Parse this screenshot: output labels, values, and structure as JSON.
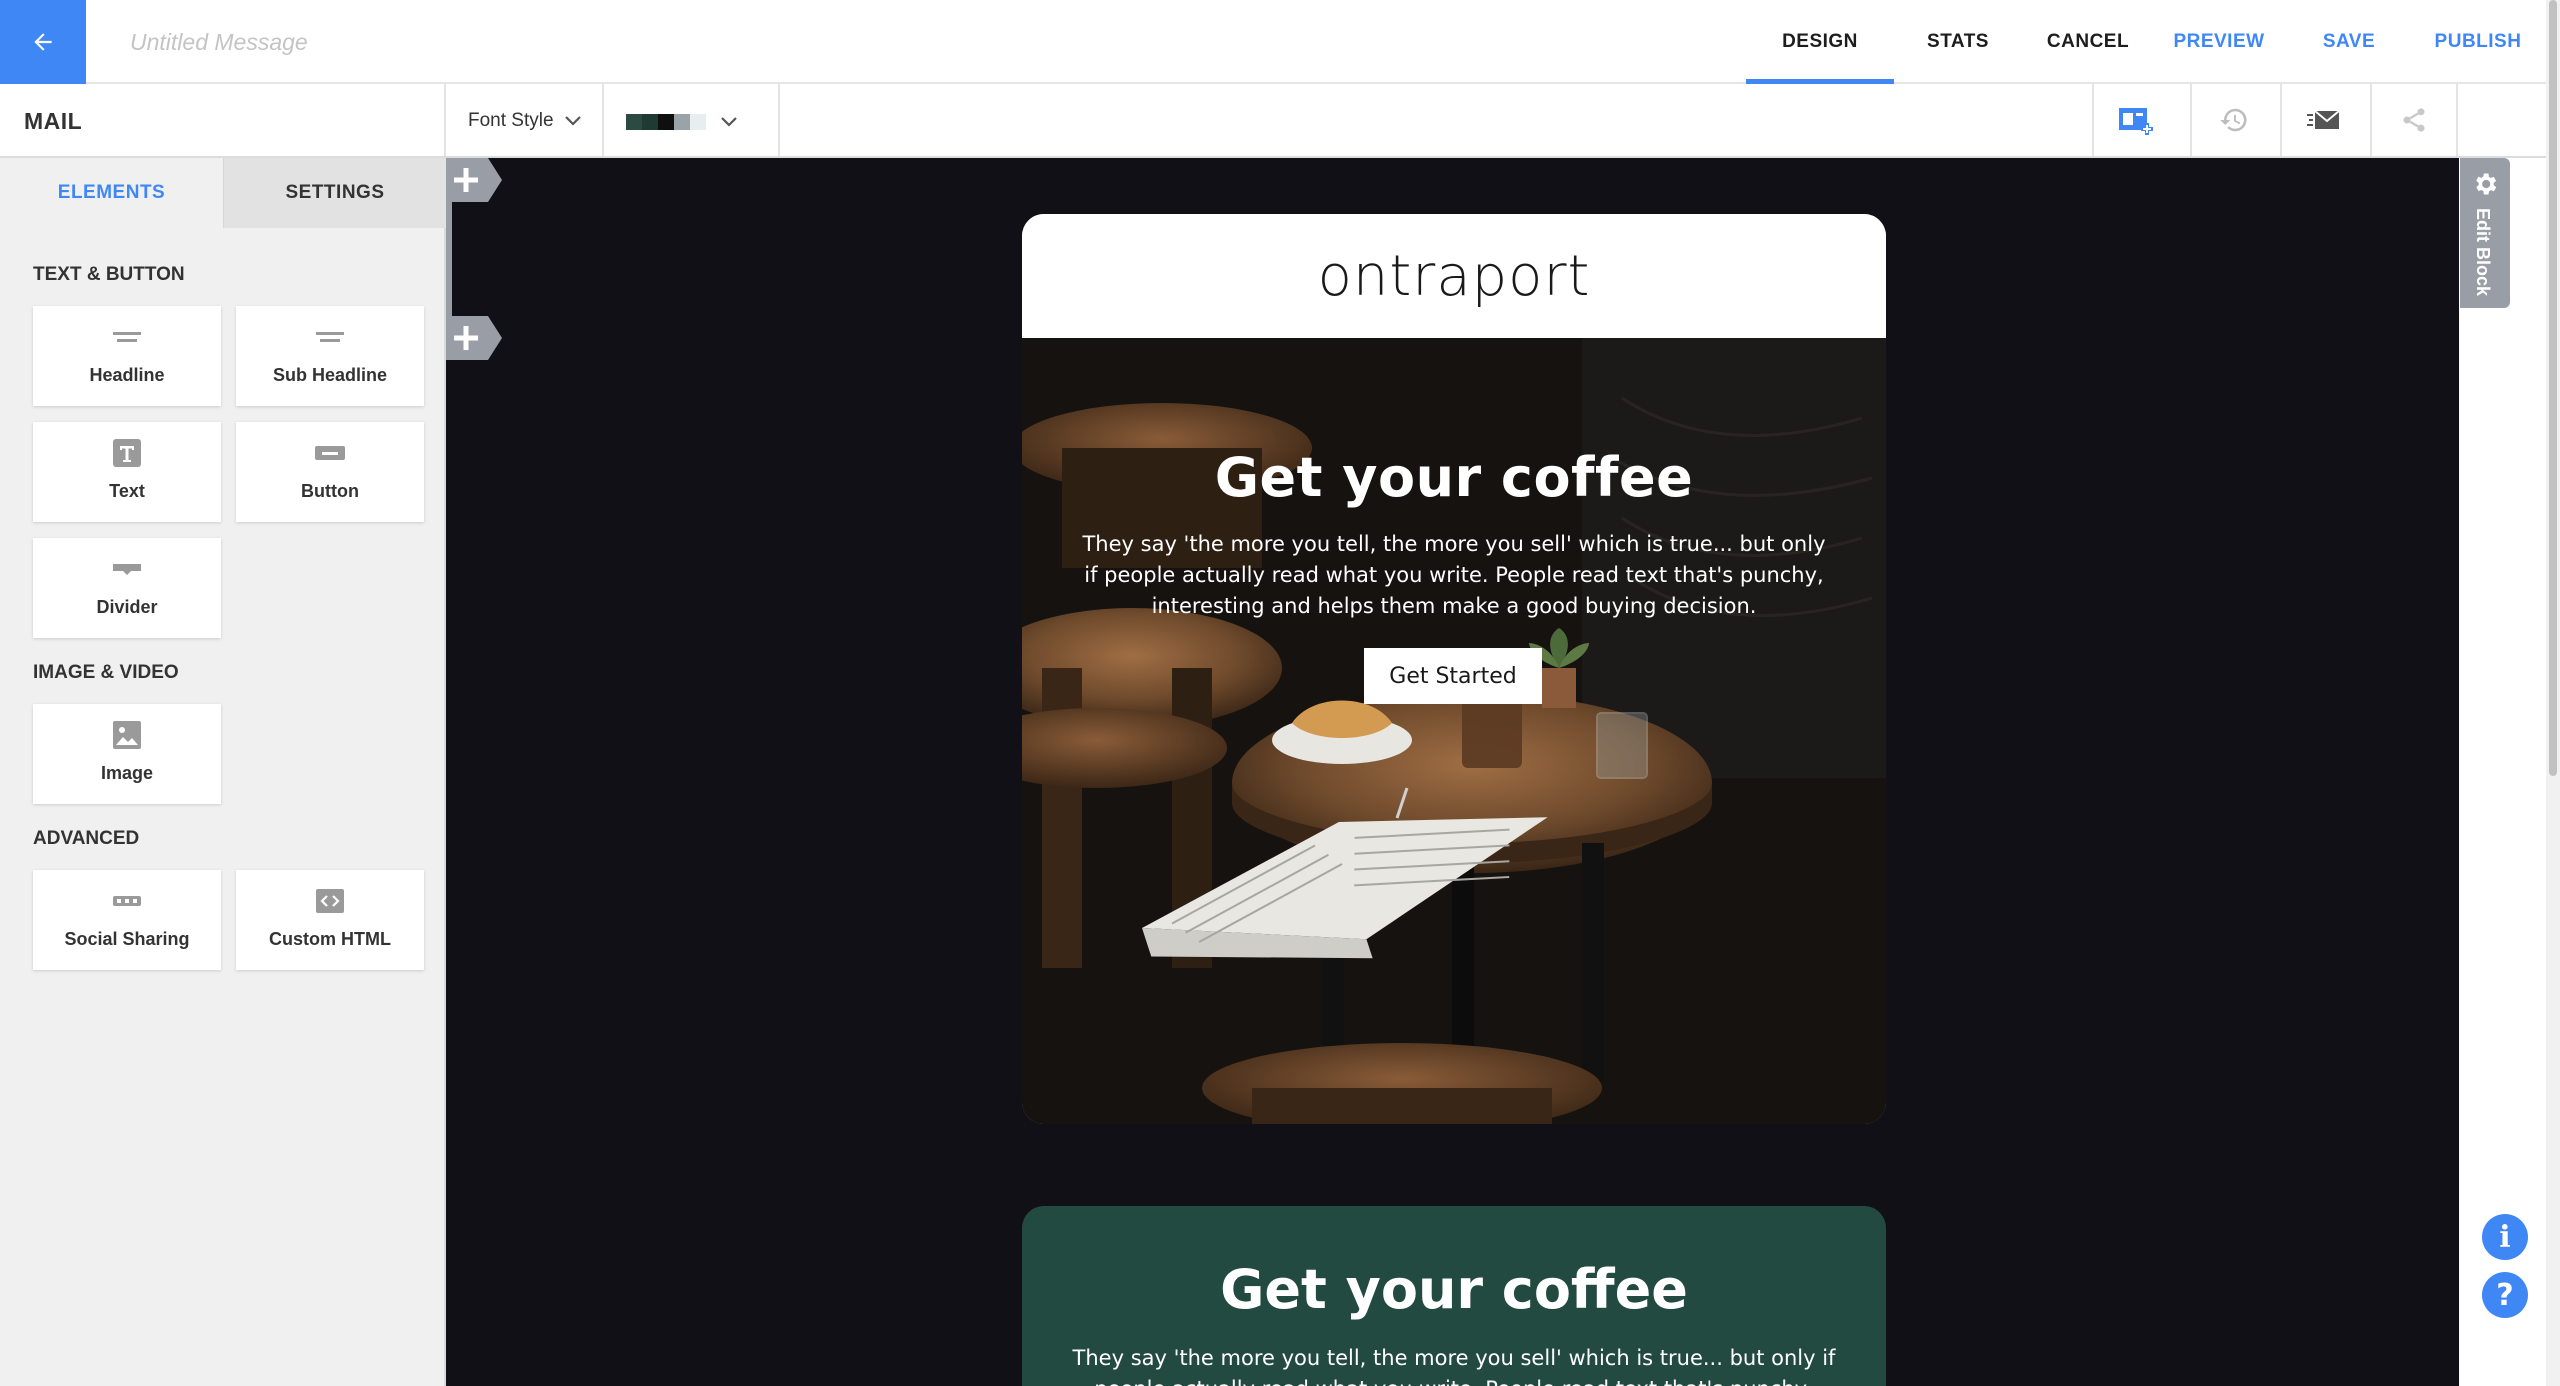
{
  "header": {
    "title_placeholder": "Untitled Message",
    "nav": {
      "design": "DESIGN",
      "stats": "STATS",
      "cancel": "CANCEL",
      "preview": "PREVIEW",
      "save": "SAVE",
      "publish": "PUBLISH"
    }
  },
  "toolbar": {
    "mail_label": "MAIL",
    "font_style": "Font Style",
    "palette_colors": [
      "#2b4a42",
      "#1e3a33",
      "#0f0f0f",
      "#9aa3a8",
      "#e8eef0"
    ]
  },
  "sidebar": {
    "tabs": {
      "elements": "ELEMENTS",
      "settings": "SETTINGS"
    },
    "sections": {
      "text_button": "TEXT & BUTTON",
      "image_video": "IMAGE & VIDEO",
      "advanced": "ADVANCED"
    },
    "tiles": {
      "headline": "Headline",
      "sub_headline": "Sub Headline",
      "text": "Text",
      "button": "Button",
      "divider": "Divider",
      "image": "Image",
      "social_sharing": "Social Sharing",
      "custom_html": "Custom HTML"
    }
  },
  "canvas": {
    "block1": {
      "logo": "ontraport",
      "title": "Get your coffee",
      "body": "They say 'the more you tell, the more you sell' which is true... but only if people actually read what you write. People read text that's punchy, interesting and helps them make a good buying decision.",
      "button": "Get Started"
    },
    "block2": {
      "title": "Get your coffee",
      "body": "They say 'the more you tell, the more you sell' which is true... but only if people actually read what you write. People read text that's punchy,"
    },
    "edit_block": "Edit Block"
  },
  "colors": {
    "accent": "#3f87f5",
    "canvas_bg": "#121017",
    "block2_bg": "#224a40"
  }
}
